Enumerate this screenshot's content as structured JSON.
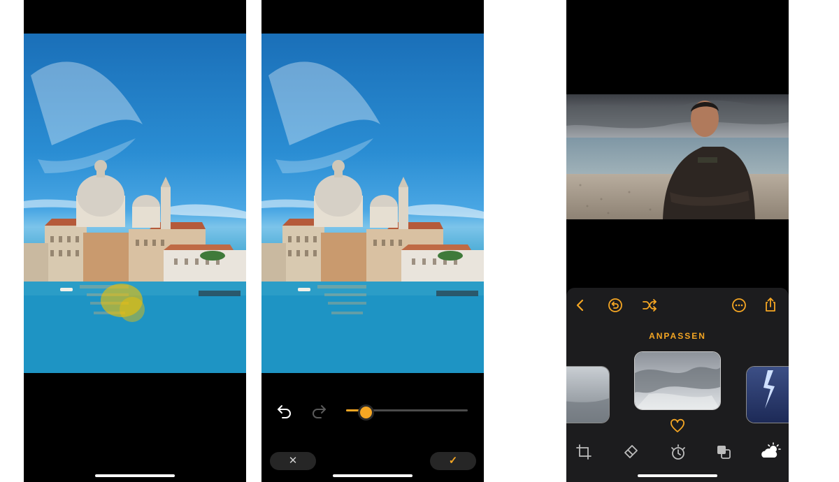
{
  "screens": [
    {
      "name": "retouch-preview"
    },
    {
      "name": "retouch-editor",
      "controls": {
        "slider_value": 0.16,
        "cancel_label": "✕",
        "confirm_label": "✓"
      },
      "colors": {
        "accent": "#f5a623"
      }
    },
    {
      "name": "sky-replacement",
      "section_title": "ANPASSEN",
      "toolbar_icons": [
        "back-icon",
        "undo-icon",
        "shuffle-icon",
        "more-icon",
        "share-icon"
      ],
      "bottom_tools": [
        "crop-icon",
        "eraser-icon",
        "timer-icon",
        "layers-icon",
        "weather-icon"
      ],
      "colors": {
        "accent": "#f5a623"
      }
    }
  ]
}
